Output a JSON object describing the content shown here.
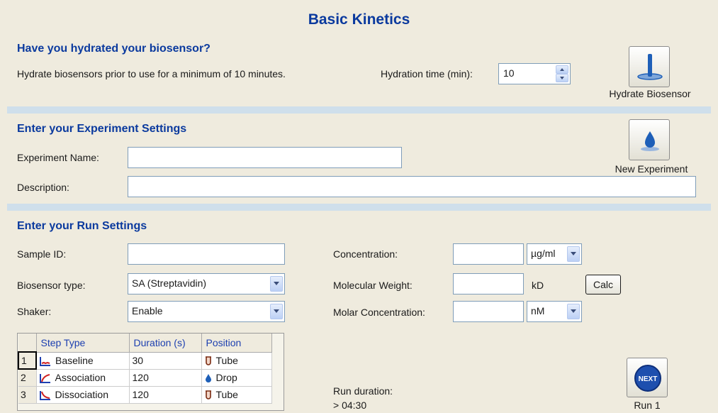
{
  "page_title": "Basic Kinetics",
  "hydration": {
    "heading": "Have you hydrated your biosensor?",
    "note": "Hydrate biosensors prior to use for a minimum of 10 minutes.",
    "time_label": "Hydration time (min):",
    "time_value": "10",
    "button_label": "Hydrate Biosensor"
  },
  "experiment": {
    "heading": "Enter your Experiment Settings",
    "name_label": "Experiment Name:",
    "name_value": "",
    "description_label": "Description:",
    "description_value": "",
    "button_label": "New Experiment"
  },
  "run": {
    "heading": "Enter your Run Settings",
    "sample_id_label": "Sample ID:",
    "sample_id_value": "",
    "biosensor_label": "Biosensor type:",
    "biosensor_value": "SA (Streptavidin)",
    "shaker_label": "Shaker:",
    "shaker_value": "Enable",
    "concentration_label": "Concentration:",
    "concentration_value": "",
    "concentration_unit": "µg/ml",
    "mw_label": "Molecular Weight:",
    "mw_value": "",
    "mw_unit": "kD",
    "calc_label": "Calc",
    "molar_label": "Molar Concentration:",
    "molar_value": "",
    "molar_unit": "nM",
    "duration_label": "Run duration:",
    "duration_value": "> 04:30",
    "run_button_label": "Run 1",
    "next_icon_text": "NEXT"
  },
  "steps": {
    "columns": [
      "Step Type",
      "Duration (s)",
      "Position"
    ],
    "rows": [
      {
        "num": "1",
        "type": "Baseline",
        "duration": "30",
        "position": "Tube",
        "type_icon": "baseline-icon",
        "position_icon": "tube-icon"
      },
      {
        "num": "2",
        "type": "Association",
        "duration": "120",
        "position": "Drop",
        "type_icon": "association-icon",
        "position_icon": "drop-icon"
      },
      {
        "num": "3",
        "type": "Dissociation",
        "duration": "120",
        "position": "Tube",
        "type_icon": "dissociation-icon",
        "position_icon": "tube-icon"
      }
    ]
  },
  "colors": {
    "background": "#efebde",
    "heading": "#0b3a9e",
    "band": "#cfdfeb",
    "icon_blue": "#1e5fb8"
  }
}
